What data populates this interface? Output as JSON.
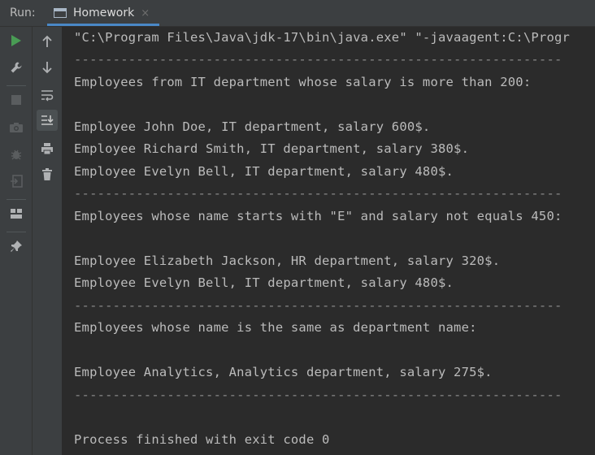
{
  "header": {
    "run_label": "Run:",
    "tab_label": "Homework",
    "tab_close": "×"
  },
  "toolbar_left": [
    "run-icon",
    "wrench-icon",
    "stop-icon",
    "camera-icon",
    "debug-icon",
    "exit-icon",
    "layout-icon",
    "pin-icon"
  ],
  "toolbar_right": [
    "arrow-up-icon",
    "arrow-down-icon",
    "soft-wrap-icon",
    "scroll-to-end-icon",
    "print-icon",
    "trash-icon"
  ],
  "colors": {
    "run_green": "#499c54",
    "tab_underline": "#4a88c7",
    "console_bg": "#2b2b2b",
    "toolbar_bg": "#3c3f41"
  },
  "console": {
    "lines": [
      "\"C:\\Program Files\\Java\\jdk-17\\bin\\java.exe\" \"-javaagent:C:\\Progr",
      "---------------------------------------------------------------",
      "Employees from IT department whose salary is more than 200:",
      "",
      "Employee John Doe, IT department, salary 600$.",
      "Employee Richard Smith, IT department, salary 380$.",
      "Employee Evelyn Bell, IT department, salary 480$.",
      "---------------------------------------------------------------",
      "Employees whose name starts with \"E\" and salary not equals 450:",
      "",
      "Employee Elizabeth Jackson, HR department, salary 320$.",
      "Employee Evelyn Bell, IT department, salary 480$.",
      "---------------------------------------------------------------",
      "Employees whose name is the same as department name:",
      "",
      "Employee Analytics, Analytics department, salary 275$.",
      "---------------------------------------------------------------",
      "",
      "",
      "Process finished with exit code 0"
    ]
  }
}
